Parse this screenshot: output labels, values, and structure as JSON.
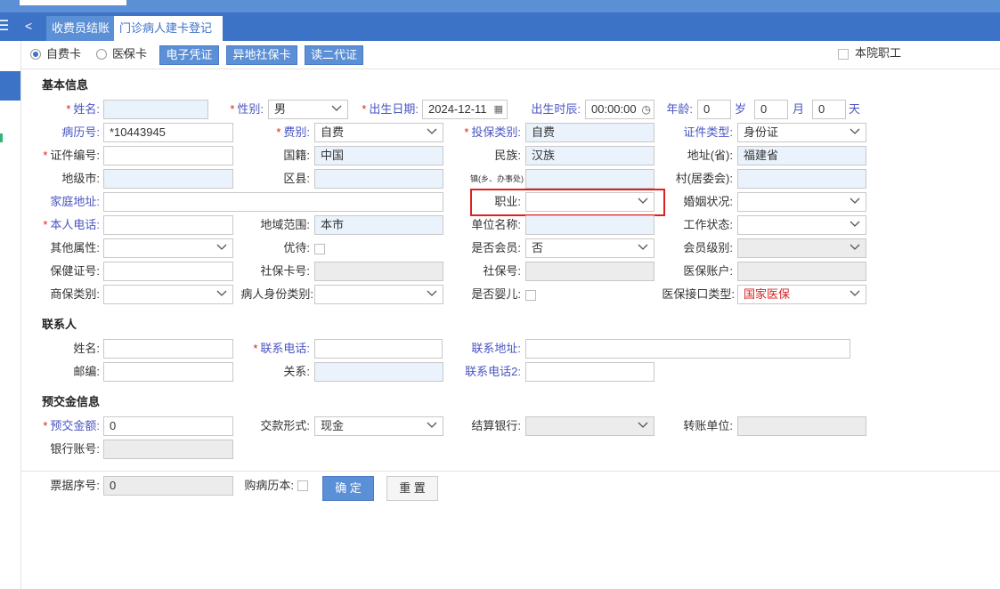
{
  "tabs": {
    "tab1": "收费员结账",
    "tab2": "门诊病人建卡登记",
    "close": "×"
  },
  "nav": {
    "hamburger": "☰",
    "back": "<"
  },
  "cardtype": {
    "self": "自费卡",
    "insurance": "医保卡",
    "btn_ecert": "电子凭证",
    "btn_remote": "异地社保卡",
    "btn_idcard": "读二代证",
    "staff": "本院职工"
  },
  "sections": {
    "basic": "基本信息",
    "contact": "联系人",
    "prepay": "预交金信息"
  },
  "basic": {
    "name": {
      "label": "姓名:",
      "value": ""
    },
    "gender": {
      "label": "性别:",
      "value": "男"
    },
    "birthdate": {
      "label": "出生日期:",
      "value": "2024-12-11"
    },
    "birthtime": {
      "label": "出生时辰:",
      "value": "00:00:00"
    },
    "age": {
      "label": "年龄:",
      "years": "0",
      "y_unit": "岁",
      "months": "0",
      "m_unit": "月",
      "days": "0",
      "d_unit": "天"
    },
    "record_no": {
      "label": "病历号:",
      "value": "*10443945"
    },
    "fee_type": {
      "label": "费别:",
      "value": "自费"
    },
    "ins_type": {
      "label": "投保类别:",
      "value": "自费"
    },
    "id_type": {
      "label": "证件类型:",
      "value": "身份证"
    },
    "id_no": {
      "label": "证件编号:",
      "value": ""
    },
    "nation": {
      "label": "国籍:",
      "value": "中国"
    },
    "ethnic": {
      "label": "民族:",
      "value": "汉族"
    },
    "province": {
      "label": "地址(省):",
      "value": "福建省"
    },
    "city": {
      "label": "地级市:",
      "value": ""
    },
    "county": {
      "label": "区县:",
      "value": ""
    },
    "town": {
      "label": "镇(乡、办事处)",
      "value": ""
    },
    "village": {
      "label": "村(居委会):",
      "value": ""
    },
    "home": {
      "label": "家庭地址:",
      "value": ""
    },
    "occupation": {
      "label": "职业:",
      "value": ""
    },
    "marital": {
      "label": "婚姻状况:",
      "value": ""
    },
    "phone": {
      "label": "本人电话:",
      "value": ""
    },
    "region": {
      "label": "地域范围:",
      "value": "本市"
    },
    "employer": {
      "label": "单位名称:",
      "value": ""
    },
    "work_status": {
      "label": "工作状态:",
      "value": ""
    },
    "other_attr": {
      "label": "其他属性:",
      "value": ""
    },
    "priority": {
      "label": "优待:"
    },
    "member": {
      "label": "是否会员:",
      "value": "否"
    },
    "member_level": {
      "label": "会员级别:",
      "value": ""
    },
    "health_no": {
      "label": "保健证号:",
      "value": ""
    },
    "si_card": {
      "label": "社保卡号:",
      "value": ""
    },
    "si_no": {
      "label": "社保号:",
      "value": ""
    },
    "mi_account": {
      "label": "医保账户:",
      "value": ""
    },
    "comm_ins": {
      "label": "商保类别:",
      "value": ""
    },
    "identity": {
      "label": "病人身份类别:",
      "value": ""
    },
    "infant": {
      "label": "是否婴儿:"
    },
    "mi_iface": {
      "label": "医保接口类型:",
      "value": "国家医保"
    }
  },
  "contact": {
    "name": {
      "label": "姓名:",
      "value": ""
    },
    "phone": {
      "label": "联系电话:",
      "value": ""
    },
    "address": {
      "label": "联系地址:",
      "value": ""
    },
    "zip": {
      "label": "邮编:",
      "value": ""
    },
    "relation": {
      "label": "关系:",
      "value": ""
    },
    "phone2": {
      "label": "联系电话2:",
      "value": ""
    }
  },
  "prepay": {
    "amount": {
      "label": "预交金额:",
      "value": "0"
    },
    "pay_method": {
      "label": "交款形式:",
      "value": "现金"
    },
    "bank": {
      "label": "结算银行:",
      "value": ""
    },
    "transfer": {
      "label": "转账单位:",
      "value": ""
    },
    "account": {
      "label": "银行账号:",
      "value": ""
    }
  },
  "footer": {
    "receipt_label": "票据序号:",
    "receipt_value": "0",
    "buy_book": "购病历本:",
    "confirm": "确 定",
    "reset": "重 置"
  },
  "colors": {
    "accent": "#3d73c7",
    "label_blue": "#4a55c2",
    "required": "#d92121",
    "highlight": "#e02020"
  }
}
